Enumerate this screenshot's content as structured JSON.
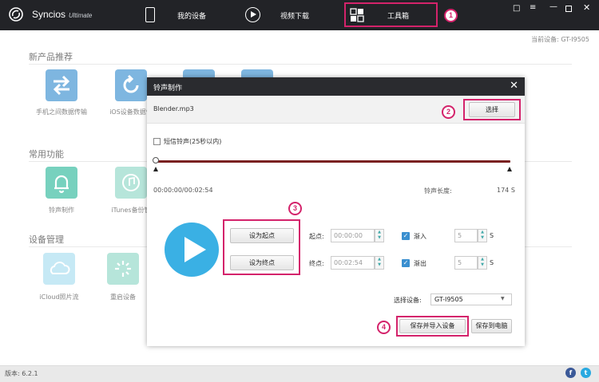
{
  "header": {
    "app_name": "Syncios",
    "app_edition": "Ultimate",
    "nav": [
      {
        "label": "我的设备",
        "icon": "phone-icon"
      },
      {
        "label": "视频下载",
        "icon": "play-circle-icon"
      },
      {
        "label": "工具箱",
        "icon": "toolbox-icon"
      }
    ],
    "window_icons": [
      "chat-icon",
      "menu-icon",
      "minimize-icon",
      "maximize-icon",
      "close-icon"
    ]
  },
  "annotations": {
    "b1": "1",
    "b2": "2",
    "b3": "3",
    "b4": "4"
  },
  "background": {
    "current_device": "当前设备: GT-I9505",
    "sections": [
      {
        "title": "新产品推荐",
        "items": [
          {
            "label": "手机之间数据传输",
            "color": "#3a8fd0",
            "icon": "transfer-icon"
          },
          {
            "label": "iOS设备数据恢",
            "color": "#3a8fd0",
            "icon": "restore-icon"
          }
        ]
      },
      {
        "title": "常用功能",
        "items": [
          {
            "label": "铃声制作",
            "color": "#2fb89c",
            "icon": "bell-icon"
          },
          {
            "label": "iTunes备份管",
            "color": "#8fd8c6",
            "icon": "music-icon"
          }
        ]
      },
      {
        "title": "设备管理",
        "items": [
          {
            "label": "iCloud照片流",
            "color": "#a8ddf0",
            "icon": "cloud-icon"
          },
          {
            "label": "重启设备",
            "color": "#8fd8c6",
            "icon": "restart-icon"
          }
        ]
      }
    ],
    "version": "版本: 6.2.1"
  },
  "dialog": {
    "title": "铃声制作",
    "filename": "Blender.mp3",
    "choose": "选择",
    "short_ringtone": "短信铃声(25秒以内)",
    "time": "00:00:00/00:02:54",
    "ring_len_label": "铃声长度:",
    "ring_len_value": "174 S",
    "set_start": "设为起点",
    "set_end": "设为终点",
    "start_label": "起点:",
    "start_value": "00:00:00",
    "end_label": "终点:",
    "end_value": "00:02:54",
    "fade_in": "渐入",
    "fade_out": "渐出",
    "fade_in_value": "5",
    "fade_out_value": "5",
    "unit": "S",
    "select_device_label": "选择设备:",
    "select_device_value": "GT-I9505",
    "save_import": "保存并导入设备",
    "save_pc": "保存到电脑"
  },
  "colors": {
    "accent": "#d4236b",
    "header": "#222327",
    "play": "#3ab0e4",
    "track": "#7a2121"
  }
}
